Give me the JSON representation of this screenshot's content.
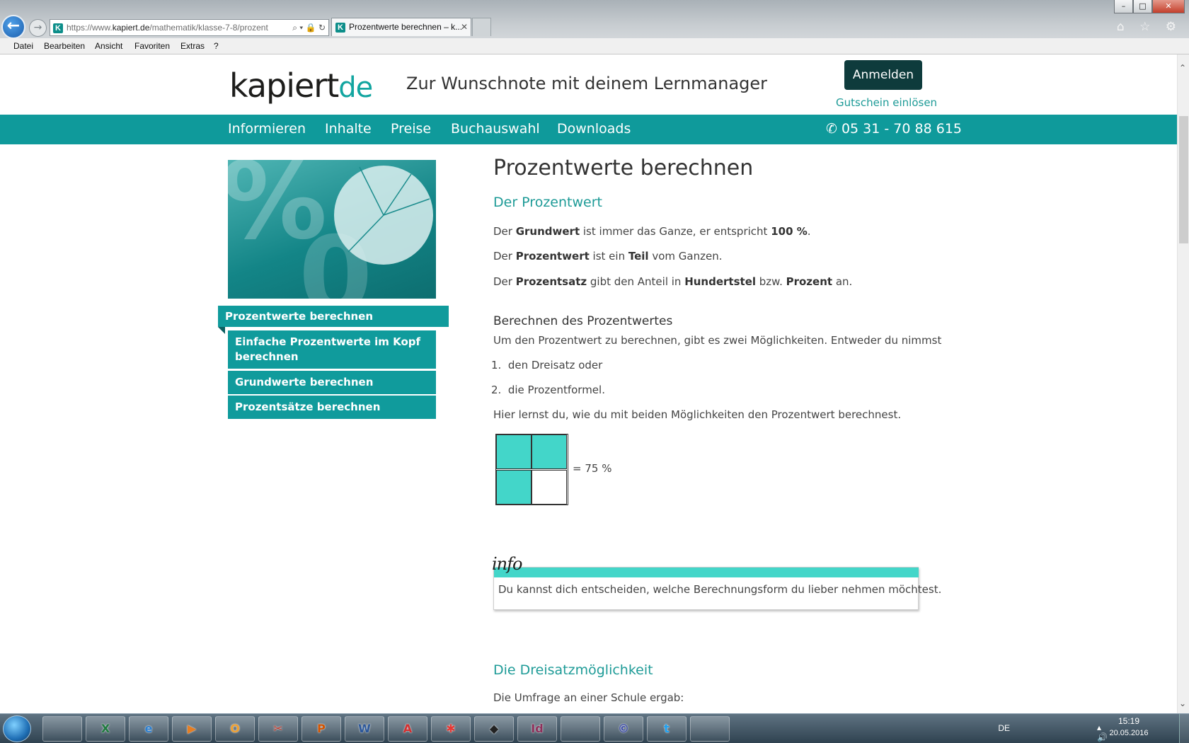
{
  "browser": {
    "window_controls": [
      "–",
      "□",
      "✕"
    ],
    "address": {
      "prefix": "https://www.",
      "domain": "kapiert.de",
      "path": "/mathematik/klasse-7-8/prozent",
      "tools": "⌕ ▾ 🔒 ↻"
    },
    "tab": {
      "title": "Prozentwerte berechnen – k...",
      "close": "✕",
      "favicon": "K"
    },
    "toolbar_icons": "⌂ ☆ ⚙",
    "menu": [
      "Datei",
      "Bearbeiten",
      "Ansicht",
      "Favoriten",
      "Extras",
      "?"
    ]
  },
  "site": {
    "logo": {
      "main": "kapiert",
      "suffix": "de"
    },
    "tagline": "Zur Wunschnote mit deinem Lernmanager",
    "login_button": "Anmelden",
    "voucher_link": "Gutschein einlösen",
    "nav": [
      "Informieren",
      "Inhalte",
      "Preise",
      "Buchauswahl",
      "Downloads"
    ],
    "phone": "05 31 - 70 88 615",
    "phone_icon": "phone-icon"
  },
  "sidebar": {
    "active": "Prozentwerte berechnen",
    "items": [
      "Einfache Prozentwerte im Kopf berechnen",
      "Grundwerte berechnen",
      "Prozentsätze berechnen"
    ]
  },
  "article": {
    "title": "Prozentwerte berechnen",
    "section1_heading": "Der Prozentwert",
    "p1": {
      "a": "Der ",
      "b": "Grundwert",
      "c": " ist immer das Ganze, er entspricht ",
      "d": "100 %",
      "e": "."
    },
    "p2": {
      "a": "Der ",
      "b": "Prozentwert",
      "c": " ist ein ",
      "d": "Teil",
      "e": " vom Ganzen."
    },
    "p3": {
      "a": "Der ",
      "b": "Prozentsatz",
      "c": " gibt den Anteil in ",
      "d": "Hundertstel",
      "e": " bzw. ",
      "f": "Prozent",
      "g": " an."
    },
    "subheading": "Berechnen des Prozentwertes",
    "intro": "Um den Prozentwert zu berechnen, gibt es zwei Möglichkeiten. Entweder du nimmst",
    "list": [
      {
        "num": "1.",
        "text": "den Dreisatz oder"
      },
      {
        "num": "2.",
        "text": "die Prozentformel."
      }
    ],
    "learn_text": "Hier lernst du, wie du mit beiden Möglichkeiten den Prozentwert berechnest.",
    "grid_label": "= 75 %",
    "grid_fill": 0.75,
    "info_logo": "info",
    "info_text": "Du kannst dich entscheiden, welche Berechnungsform du lieber nehmen möchtest.",
    "section2_heading": "Die Dreisatzmöglichkeit",
    "survey_text": "Die Umfrage an einer Schule ergab:"
  },
  "colors": {
    "teal": "#0f9a9b",
    "mint": "#43d6c9",
    "dark": "#0e3b3c",
    "link": "#1e9b97"
  },
  "taskbar": {
    "apps": [
      "folder-icon",
      "excel-icon",
      "ie-icon",
      "media-icon",
      "outlook-icon",
      "snipping-icon",
      "powerpoint-icon",
      "word-icon",
      "acrobat-icon",
      "paint-icon",
      "app-icon",
      "indesign-icon",
      "firefox-icon",
      "app-icon",
      "twitter-icon",
      "firefox-icon"
    ],
    "app_labels": [
      "",
      "X",
      "e",
      "▶",
      "O",
      "✂",
      "P",
      "W",
      "A",
      "✱",
      "◆",
      "Id",
      "",
      "©",
      "t",
      ""
    ],
    "lang": "DE",
    "tray_icons": "▴ 🔊 ⚐",
    "time": "15:19",
    "date": "20.05.2016"
  }
}
